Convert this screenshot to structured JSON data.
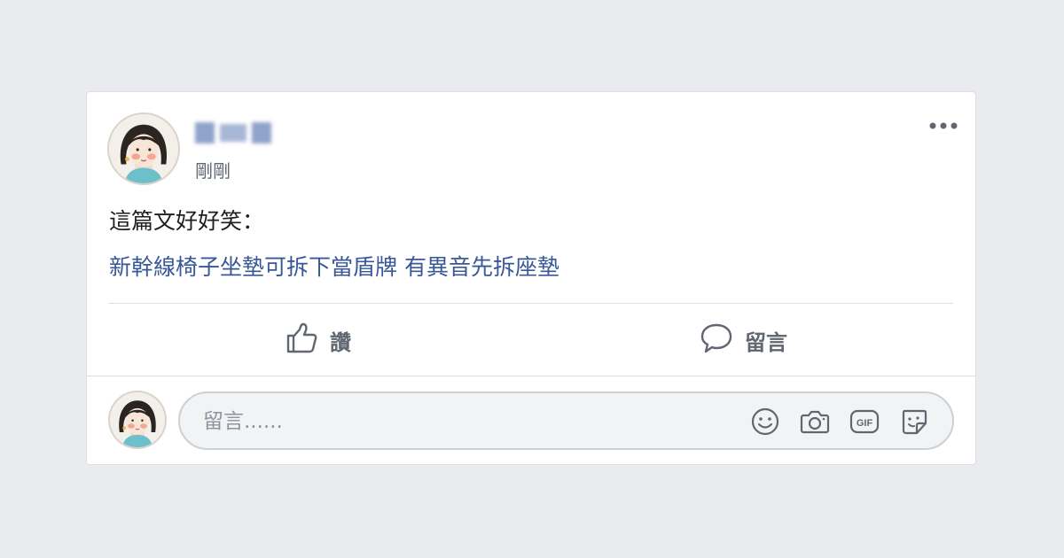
{
  "post": {
    "author_name": "",
    "timestamp": "剛剛",
    "text": "這篇文好好笑：",
    "link_text": "新幹線椅子坐墊可拆下當盾牌 有異音先拆座墊"
  },
  "actions": {
    "like_label": "讚",
    "comment_label": "留言"
  },
  "composer": {
    "placeholder": "留言......"
  },
  "icons": {
    "more": "more-icon",
    "like": "thumbs-up-icon",
    "comment": "speech-bubble-icon",
    "emoji": "emoji-icon",
    "camera": "camera-icon",
    "gif": "gif-icon",
    "sticker": "sticker-icon"
  },
  "colors": {
    "link": "#385898",
    "secondary_text": "#606770",
    "background": "#e9ebee"
  }
}
